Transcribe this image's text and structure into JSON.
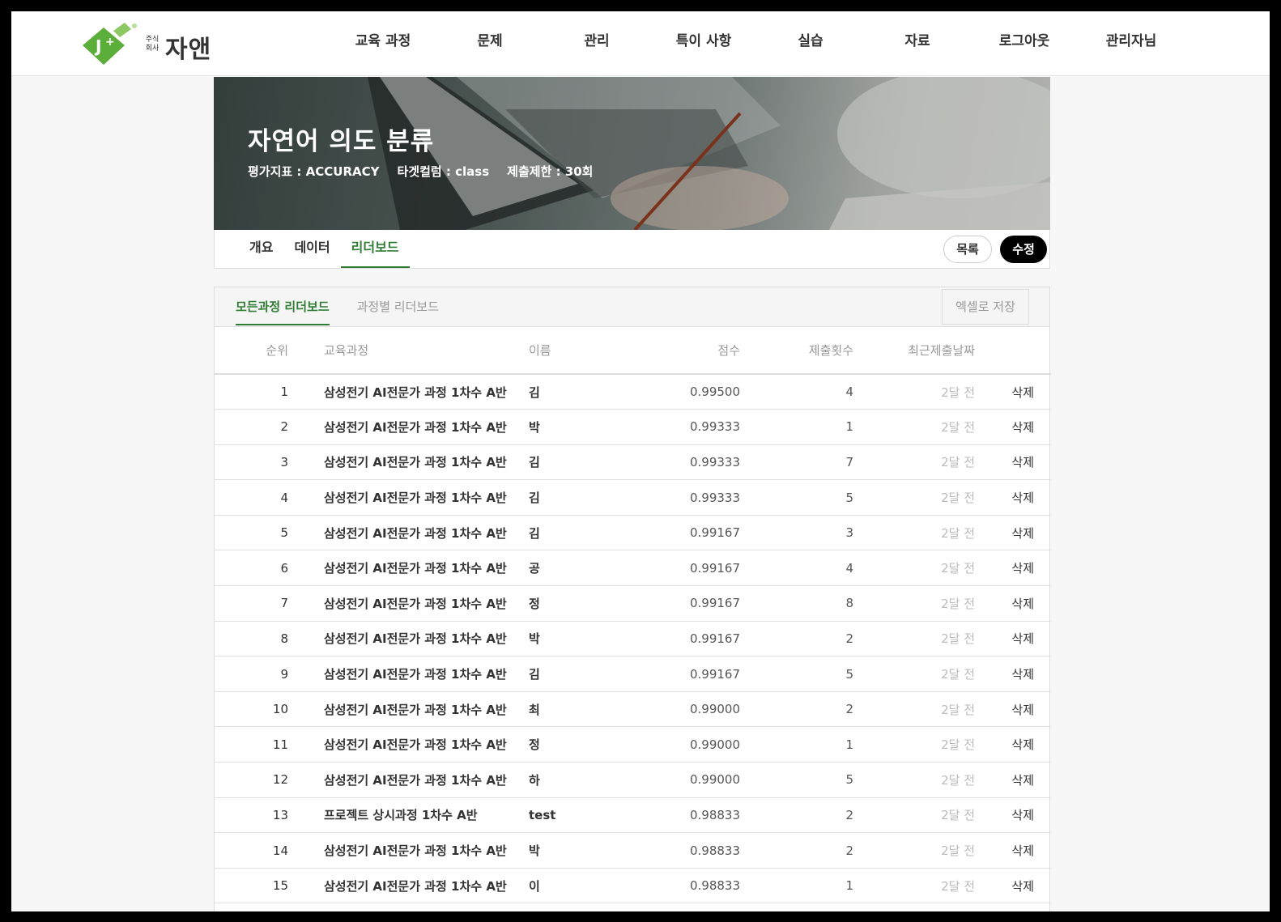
{
  "brand": {
    "logo_small_line1": "주식",
    "logo_small_line2": "회사",
    "logo_name": "자앤",
    "color": "#5cae3a"
  },
  "nav": [
    "교육 과정",
    "문제",
    "관리",
    "특이 사항",
    "실습",
    "자료",
    "로그아웃",
    "관리자님"
  ],
  "banner": {
    "title": "자연어 의도 분류",
    "metric": "평가지표 : ACCURACY",
    "target": "타겟컬럼 : class",
    "limit": "제출제한 : 30회"
  },
  "tabs": [
    "개요",
    "데이터",
    "리더보드"
  ],
  "active_tab": "리더보드",
  "buttons": {
    "list": "목록",
    "edit": "수정"
  },
  "board": {
    "tabs": [
      "모든과정 리더보드",
      "과정별 리더보드"
    ],
    "excel_button": "엑셀로 저장",
    "columns": [
      "순위",
      "교육과정",
      "이름",
      "점수",
      "제출횟수",
      "최근제출날짜"
    ],
    "rows": [
      [
        "1",
        "삼성전기 AI전문가 과정 1차수 A반",
        "김",
        "0.99500",
        "4",
        "2달 전",
        "삭제"
      ],
      [
        "2",
        "삼성전기 AI전문가 과정 1차수 A반",
        "박",
        "0.99333",
        "1",
        "2달 전",
        "삭제"
      ],
      [
        "3",
        "삼성전기 AI전문가 과정 1차수 A반",
        "김",
        "0.99333",
        "7",
        "2달 전",
        "삭제"
      ],
      [
        "4",
        "삼성전기 AI전문가 과정 1차수 A반",
        "김",
        "0.99333",
        "5",
        "2달 전",
        "삭제"
      ],
      [
        "5",
        "삼성전기 AI전문가 과정 1차수 A반",
        "김",
        "0.99167",
        "3",
        "2달 전",
        "삭제"
      ],
      [
        "6",
        "삼성전기 AI전문가 과정 1차수 A반",
        "공",
        "0.99167",
        "4",
        "2달 전",
        "삭제"
      ],
      [
        "7",
        "삼성전기 AI전문가 과정 1차수 A반",
        "정",
        "0.99167",
        "8",
        "2달 전",
        "삭제"
      ],
      [
        "8",
        "삼성전기 AI전문가 과정 1차수 A반",
        "박",
        "0.99167",
        "2",
        "2달 전",
        "삭제"
      ],
      [
        "9",
        "삼성전기 AI전문가 과정 1차수 A반",
        "김",
        "0.99167",
        "5",
        "2달 전",
        "삭제"
      ],
      [
        "10",
        "삼성전기 AI전문가 과정 1차수 A반",
        "최",
        "0.99000",
        "2",
        "2달 전",
        "삭제"
      ],
      [
        "11",
        "삼성전기 AI전문가 과정 1차수 A반",
        "정",
        "0.99000",
        "1",
        "2달 전",
        "삭제"
      ],
      [
        "12",
        "삼성전기 AI전문가 과정 1차수 A반",
        "하",
        "0.99000",
        "5",
        "2달 전",
        "삭제"
      ],
      [
        "13",
        "프로젝트 상시과정 1차수 A반",
        "test",
        "0.98833",
        "2",
        "2달 전",
        "삭제"
      ],
      [
        "14",
        "삼성전기 AI전문가 과정 1차수 A반",
        "박",
        "0.98833",
        "2",
        "2달 전",
        "삭제"
      ],
      [
        "15",
        "삼성전기 AI전문가 과정 1차수 A반",
        "이",
        "0.98833",
        "1",
        "2달 전",
        "삭제"
      ]
    ]
  }
}
